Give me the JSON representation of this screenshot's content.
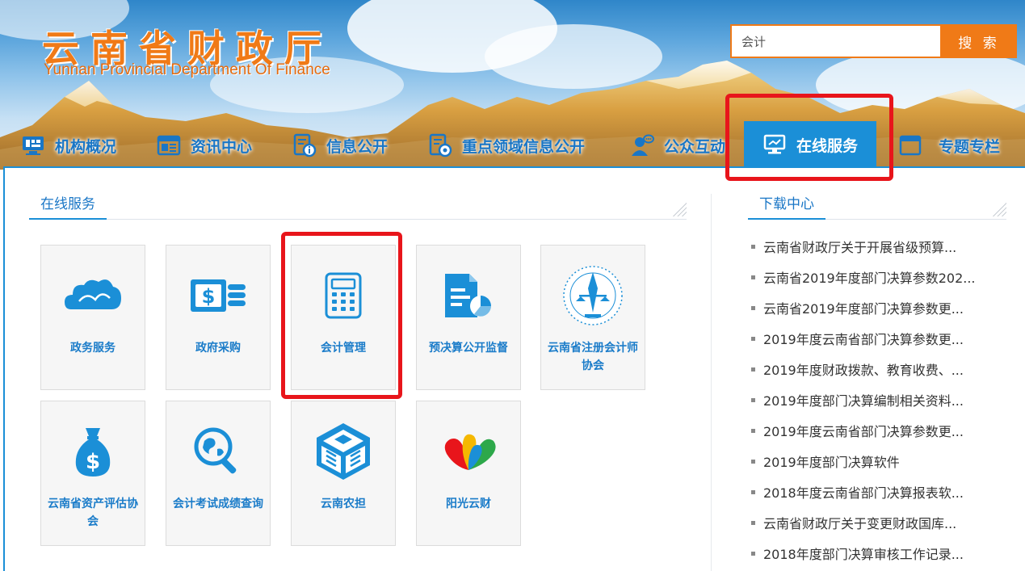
{
  "header": {
    "logo_cn": "云南省财政厅",
    "logo_en": "Yunnan Provincial Department Of Finance",
    "search_value": "会计",
    "search_button": "搜 索"
  },
  "nav": {
    "items": [
      {
        "label": "机构概况",
        "icon": "org-icon"
      },
      {
        "label": "资讯中心",
        "icon": "news-icon"
      },
      {
        "label": "信息公开",
        "icon": "info-icon"
      },
      {
        "label": "重点领域信息公开",
        "icon": "key-info-icon"
      },
      {
        "label": "公众互动",
        "icon": "interaction-icon"
      },
      {
        "label": "在线服务",
        "icon": "computer-icon",
        "active": true
      },
      {
        "label": "专题专栏",
        "icon": "window-icon"
      }
    ]
  },
  "online_service": {
    "title": "在线服务",
    "tiles": [
      {
        "label": "政务服务",
        "icon": "cloud-icon"
      },
      {
        "label": "政府采购",
        "icon": "money-card-icon"
      },
      {
        "label": "会计管理",
        "icon": "calculator-icon",
        "highlighted": true
      },
      {
        "label": "预决算公开监督",
        "icon": "document-chart-icon"
      },
      {
        "label": "云南省注册会计师协会",
        "icon": "scale-emblem-icon"
      },
      {
        "label": "云南省资产评估协会",
        "icon": "money-bag-icon"
      },
      {
        "label": "会计考试成绩查询",
        "icon": "globe-search-icon"
      },
      {
        "label": "云南农担",
        "icon": "cube-logo-icon"
      },
      {
        "label": "阳光云财",
        "icon": "peacock-logo-icon"
      }
    ]
  },
  "downloads": {
    "title": "下载中心",
    "items": [
      "云南省财政厅关于开展省级预算...",
      "云南省2019年度部门决算参数202...",
      "云南省2019年度部门决算参数更...",
      "2019年度云南省部门决算参数更...",
      "2019年度财政拨款、教育收费、...",
      "2019年度部门决算编制相关资料...",
      "2019年度云南省部门决算参数更...",
      "2019年度部门决算软件",
      "2018年度云南省部门决算报表软...",
      "云南省财政厅关于变更财政国库...",
      "2018年度部门决算审核工作记录..."
    ]
  },
  "colors": {
    "brand_orange": "#f07a17",
    "brand_blue": "#1b8fd7",
    "highlight_red": "#e8151b"
  }
}
